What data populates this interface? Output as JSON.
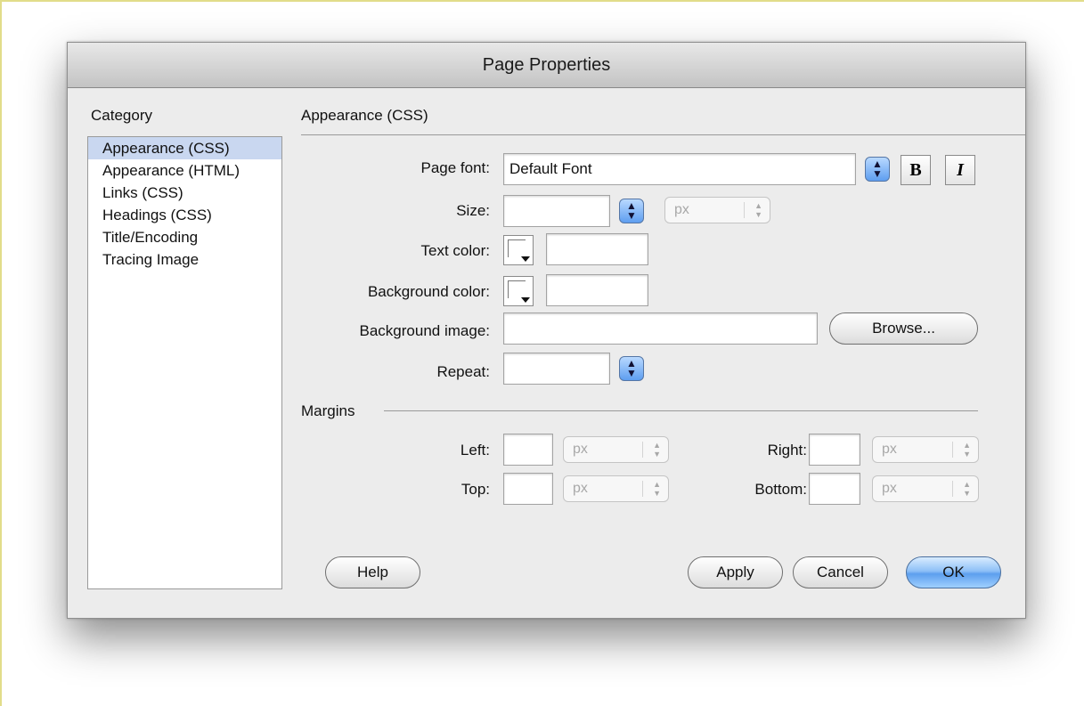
{
  "dialog": {
    "title": "Page Properties"
  },
  "category": {
    "heading": "Category",
    "items": [
      {
        "label": "Appearance (CSS)",
        "selected": true
      },
      {
        "label": "Appearance (HTML)"
      },
      {
        "label": "Links (CSS)"
      },
      {
        "label": "Headings (CSS)"
      },
      {
        "label": "Title/Encoding"
      },
      {
        "label": "Tracing Image"
      }
    ]
  },
  "panel": {
    "heading": "Appearance (CSS)",
    "page_font": {
      "label": "Page font:",
      "value": "Default Font",
      "bold_label": "B",
      "italic_label": "I"
    },
    "size": {
      "label": "Size:",
      "value": "",
      "unit": "px"
    },
    "text_color": {
      "label": "Text color:",
      "value": ""
    },
    "background_color": {
      "label": "Background color:",
      "value": ""
    },
    "background_image": {
      "label": "Background image:",
      "value": "",
      "browse_label": "Browse..."
    },
    "repeat": {
      "label": "Repeat:",
      "value": ""
    }
  },
  "margins": {
    "heading": "Margins",
    "left": {
      "label": "Left:",
      "value": "",
      "unit": "px"
    },
    "right": {
      "label": "Right:",
      "value": "",
      "unit": "px"
    },
    "top": {
      "label": "Top:",
      "value": "",
      "unit": "px"
    },
    "bottom": {
      "label": "Bottom:",
      "value": "",
      "unit": "px"
    }
  },
  "buttons": {
    "help": "Help",
    "apply": "Apply",
    "cancel": "Cancel",
    "ok": "OK"
  },
  "colors": {
    "selection": "#c9d7f0",
    "dialog_bg": "#ececec",
    "accent_blue": "#5e9ef0"
  },
  "icons": {
    "stepper": "up-down-arrows-icon",
    "color_dropdown": "dropdown-triangle-icon"
  }
}
